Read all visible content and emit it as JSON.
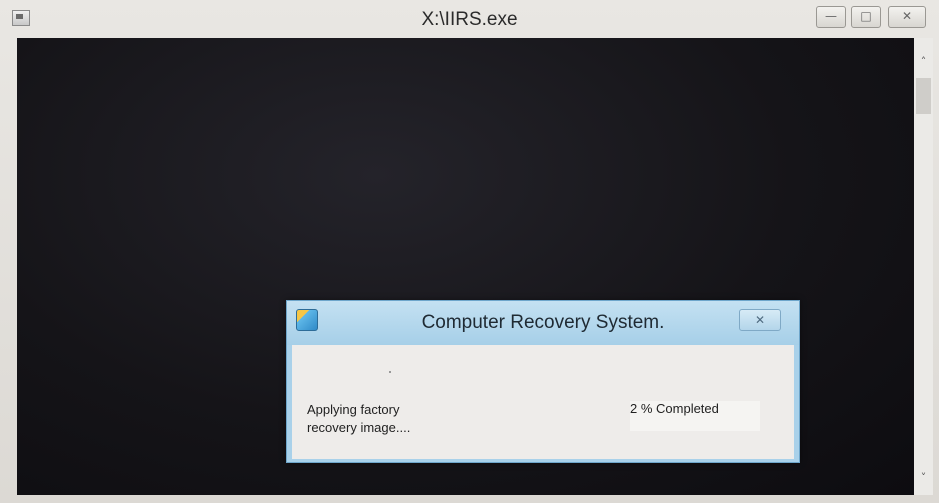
{
  "window": {
    "title": "X:\\IIRS.exe",
    "controls": {
      "minimize": "—",
      "maximize": "□",
      "close": "✕"
    },
    "console_background": "#151418"
  },
  "scrollbar": {
    "up_arrow": "˄",
    "down_arrow": "˅"
  },
  "dialog": {
    "title": "Computer Recovery System.",
    "close_glyph": "✕",
    "status_line1": "Applying factory",
    "status_line2": "recovery image....",
    "progress_text": "2 % Completed",
    "progress_percent": 2,
    "titlebar_color": "#a9d1ea"
  },
  "icons": {
    "window_icon": "console-window-icon",
    "dialog_icon": "recovery-system-icon"
  }
}
